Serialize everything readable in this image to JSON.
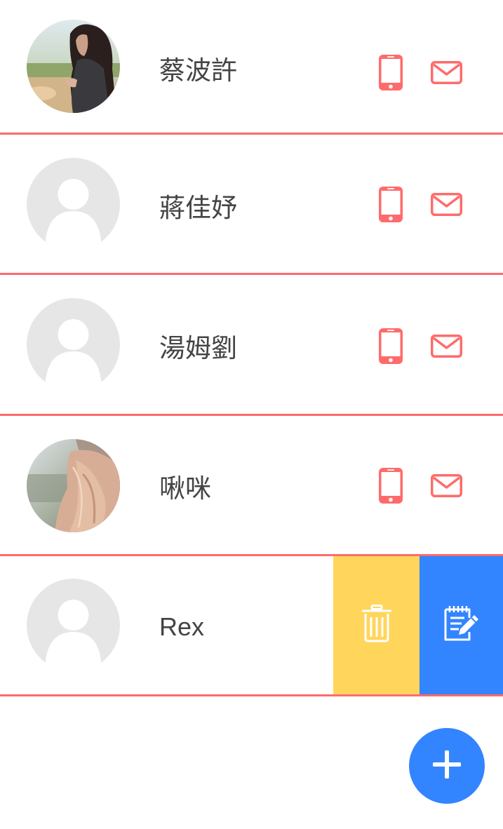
{
  "colors": {
    "accent": "#ff6b6b",
    "delete_action": "#ffd55c",
    "edit_action": "#3384ff",
    "fab": "#3384ff",
    "placeholder_avatar": "#e6e6e6",
    "name_text": "#444444"
  },
  "contacts": [
    {
      "name": "蔡波許",
      "avatar": "photo-woman-phone",
      "actions": [
        "phone-icon",
        "mail-icon"
      ]
    },
    {
      "name": "蔣佳妤",
      "avatar": "default-avatar",
      "actions": [
        "phone-icon",
        "mail-icon"
      ]
    },
    {
      "name": "湯姆劉",
      "avatar": "default-avatar",
      "actions": [
        "phone-icon",
        "mail-icon"
      ]
    },
    {
      "name": "啾咪",
      "avatar": "photo-woman-hat",
      "actions": [
        "phone-icon",
        "mail-icon"
      ]
    },
    {
      "name": "Rex",
      "avatar": "default-avatar",
      "swipe_actions": [
        "trash-icon",
        "edit-note-icon"
      ]
    }
  ],
  "fab": {
    "icon": "plus-icon"
  }
}
